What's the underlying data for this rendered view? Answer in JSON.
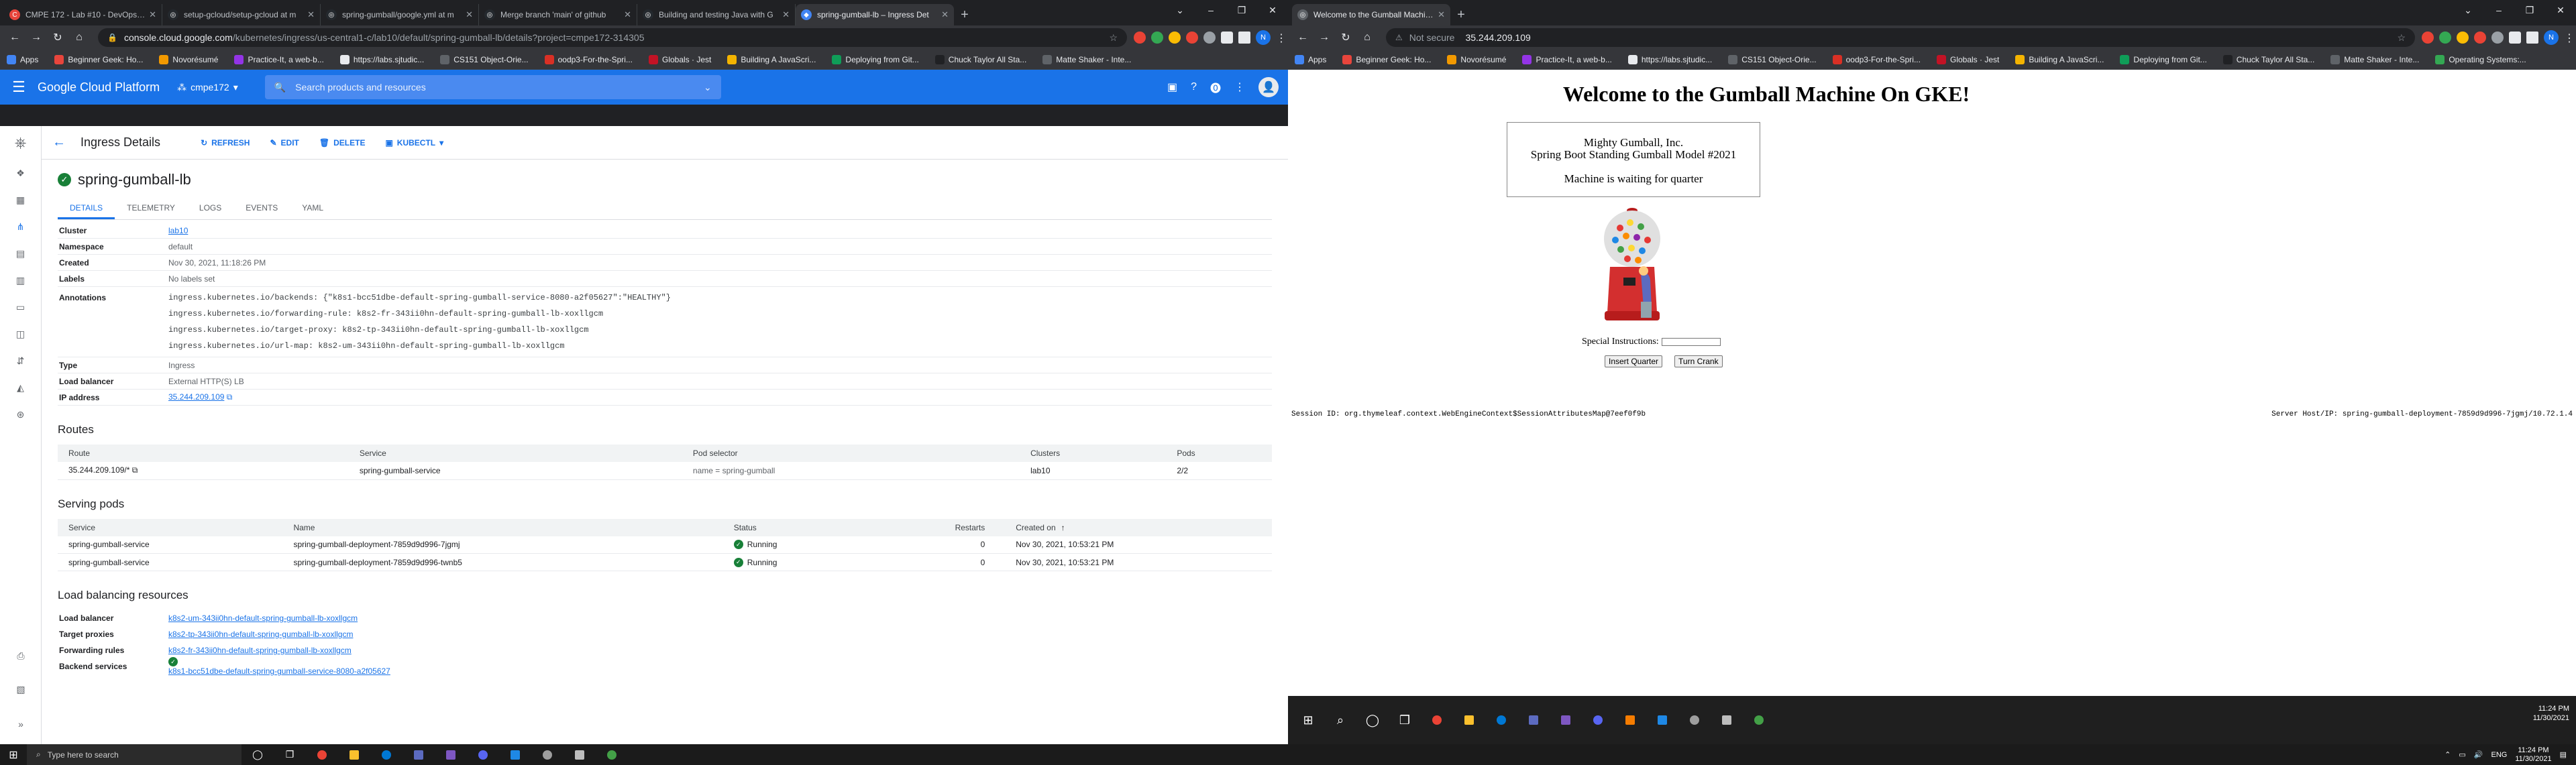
{
  "left_browser": {
    "tabs": [
      {
        "title": "CMPE 172 - Lab #10 - DevOps Dep",
        "color": "#e8453c",
        "glyph": "C"
      },
      {
        "title": "setup-gcloud/setup-gcloud at m",
        "color": "#24292e",
        "glyph": "◎"
      },
      {
        "title": "spring-gumball/google.yml at m",
        "color": "#24292e",
        "glyph": "◎"
      },
      {
        "title": "Merge branch 'main' of github",
        "color": "#24292e",
        "glyph": "◎"
      },
      {
        "title": "Building and testing Java with G",
        "color": "#24292e",
        "glyph": "◎"
      },
      {
        "title": "spring-gumball-lb – Ingress Det",
        "color": "#4285f4",
        "glyph": "◆"
      }
    ],
    "new_tab": "+",
    "address": {
      "host": "console.cloud.google.com",
      "path": "/kubernetes/ingress/us-central1-c/lab10/default/spring-gumball-lb/details?project=cmpe172-314305"
    },
    "bookmarks": [
      {
        "label": "Apps",
        "color": "#4285f4"
      },
      {
        "label": "Beginner Geek: Ho...",
        "color": "#e8453c"
      },
      {
        "label": "Novorésumé",
        "color": "#f29900"
      },
      {
        "label": "Practice-It, a web-b...",
        "color": "#9334e6"
      },
      {
        "label": "https://labs.sjtudic...",
        "color": "#e8eaed"
      },
      {
        "label": "CS151 Object-Orie...",
        "color": "#5f6368"
      },
      {
        "label": "oodp3-For-the-Spri...",
        "color": "#d93025"
      },
      {
        "label": "Globals · Jest",
        "color": "#c21325"
      },
      {
        "label": "Building A JavaScri...",
        "color": "#f4b400"
      },
      {
        "label": "Deploying from Git...",
        "color": "#0f9d58"
      },
      {
        "label": "Chuck Taylor All Sta...",
        "color": "#202124"
      },
      {
        "label": "Matte Shaker - Inte...",
        "color": "#5f6368"
      }
    ]
  },
  "gcp": {
    "brand": "Google Cloud Platform",
    "project": "cmpe172",
    "search_placeholder": "Search products and resources",
    "avatar": "👤",
    "page_heading": "Ingress Details",
    "actions": {
      "refresh": "REFRESH",
      "edit": "EDIT",
      "delete": "DELETE",
      "kubectl": "KUBECTL"
    },
    "ingress_name": "spring-gumball-lb",
    "subtabs": [
      "DETAILS",
      "TELEMETRY",
      "LOGS",
      "EVENTS",
      "YAML"
    ],
    "details": {
      "cluster_label": "Cluster",
      "cluster": "lab10",
      "namespace_label": "Namespace",
      "namespace": "default",
      "created_label": "Created",
      "created": "Nov 30, 2021, 11:18:26 PM",
      "labels_label": "Labels",
      "labels": "No labels set",
      "annotations_label": "Annotations",
      "annotations": [
        "ingress.kubernetes.io/backends: {\"k8s1-bcc51dbe-default-spring-gumball-service-8080-a2f05627\":\"HEALTHY\"}",
        "ingress.kubernetes.io/forwarding-rule: k8s2-fr-343ii0hn-default-spring-gumball-lb-xoxllgcm",
        "ingress.kubernetes.io/target-proxy: k8s2-tp-343ii0hn-default-spring-gumball-lb-xoxllgcm",
        "ingress.kubernetes.io/url-map: k8s2-um-343ii0hn-default-spring-gumball-lb-xoxllgcm"
      ],
      "type_label": "Type",
      "type": "Ingress",
      "lb_label": "Load balancer",
      "lb": "External HTTP(S) LB",
      "ip_label": "IP address",
      "ip": "35.244.209.109"
    },
    "routes": {
      "title": "Routes",
      "columns": [
        "Route",
        "Service",
        "Pod selector",
        "Clusters",
        "Pods"
      ],
      "rows": [
        [
          "35.244.209.109/*",
          "spring-gumball-service",
          "name = spring-gumball",
          "lab10",
          "2/2"
        ]
      ]
    },
    "pods": {
      "title": "Serving pods",
      "columns": [
        "Service",
        "Name",
        "Status",
        "Restarts",
        "Created on"
      ],
      "rows": [
        [
          "spring-gumball-service",
          "spring-gumball-deployment-7859d9d996-7jgmj",
          "Running",
          "0",
          "Nov 30, 2021, 10:53:21 PM"
        ],
        [
          "spring-gumball-service",
          "spring-gumball-deployment-7859d9d996-twnb5",
          "Running",
          "0",
          "Nov 30, 2021, 10:53:21 PM"
        ]
      ]
    },
    "lbr": {
      "title": "Load balancing resources",
      "items": [
        {
          "label": "Load balancer",
          "value": "k8s2-um-343ii0hn-default-spring-gumball-lb-xoxllgcm"
        },
        {
          "label": "Target proxies",
          "value": "k8s2-tp-343ii0hn-default-spring-gumball-lb-xoxllgcm"
        },
        {
          "label": "Forwarding rules",
          "value": "k8s2-fr-343ii0hn-default-spring-gumball-lb-xoxllgcm"
        },
        {
          "label": "Backend services",
          "value": "k8s1-bcc51dbe-default-spring-gumball-service-8080-a2f05627"
        }
      ]
    }
  },
  "right_browser": {
    "tab_title": "Welcome to the Gumball Machine",
    "address_security": "Not secure",
    "address": "35.244.209.109",
    "bookmarks": [
      {
        "label": "Apps",
        "color": "#4285f4"
      },
      {
        "label": "Beginner Geek: Ho...",
        "color": "#e8453c"
      },
      {
        "label": "Novorésumé",
        "color": "#f29900"
      },
      {
        "label": "Practice-It, a web-b...",
        "color": "#9334e6"
      },
      {
        "label": "https://labs.sjtudic...",
        "color": "#e8eaed"
      },
      {
        "label": "CS151 Object-Orie...",
        "color": "#5f6368"
      },
      {
        "label": "oodp3-For-the-Spri...",
        "color": "#d93025"
      },
      {
        "label": "Globals · Jest",
        "color": "#c21325"
      },
      {
        "label": "Building A JavaScri...",
        "color": "#f4b400"
      },
      {
        "label": "Deploying from Git...",
        "color": "#0f9d58"
      },
      {
        "label": "Chuck Taylor All Sta...",
        "color": "#202124"
      },
      {
        "label": "Matte Shaker - Inte...",
        "color": "#5f6368"
      },
      {
        "label": "Operating Systems:...",
        "color": "#34a853"
      }
    ],
    "page": {
      "title": "Welcome to the Gumball Machine On GKE!",
      "company": "Mighty Gumball, Inc.",
      "model": "Spring Boot Standing Gumball Model #2021",
      "message": "Machine is waiting for quarter",
      "special_label": "Special Instructions:",
      "insert_quarter": "Insert Quarter",
      "turn_crank": "Turn Crank",
      "session": "Session ID:  org.thymeleaf.context.WebEngineContext$SessionAttributesMap@7eef0f9b",
      "host": "Server Host/IP:  spring-gumball-deployment-7859d9d996-7jgmj/10.72.1.4"
    }
  },
  "taskbar": {
    "search_placeholder": "Type here to search",
    "lang": "ENG",
    "time": "11:24 PM",
    "date": "11/30/2021"
  }
}
